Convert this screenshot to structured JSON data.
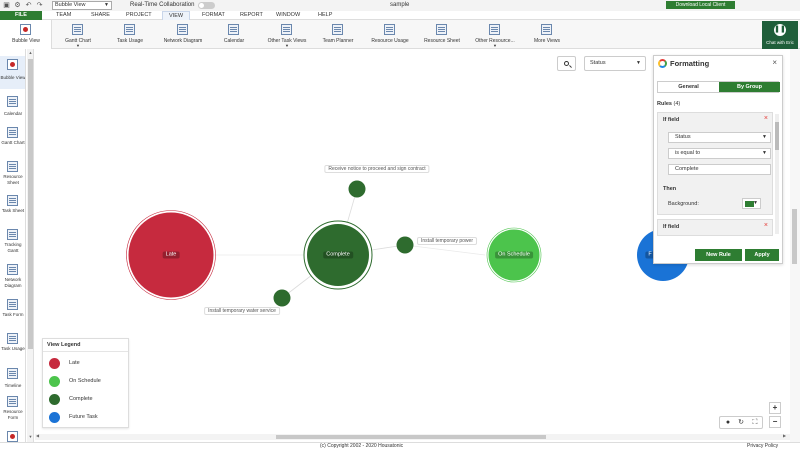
{
  "titlebar": {
    "view_name": "Bubble View",
    "rtc_label": "Real-Time Collaboration",
    "doc_title": "sample",
    "download_label": "Download Local Client"
  },
  "menu": {
    "file": "FILE",
    "items": [
      "TEAM",
      "SHARE",
      "PROJECT",
      "VIEW",
      "FORMAT",
      "REPORT",
      "WINDOW",
      "HELP"
    ],
    "active": "VIEW"
  },
  "ribbon": {
    "items": [
      {
        "label": "Bubble View",
        "dropdown": false
      },
      {
        "label": "Gantt Chart",
        "dropdown": true
      },
      {
        "label": "Task Usage",
        "dropdown": false
      },
      {
        "label": "Network Diagram",
        "dropdown": false
      },
      {
        "label": "Calendar",
        "dropdown": false
      },
      {
        "label": "Other Task Views",
        "dropdown": true
      },
      {
        "label": "Team Planner",
        "dropdown": false
      },
      {
        "label": "Resource Usage",
        "dropdown": false
      },
      {
        "label": "Resource Sheet",
        "dropdown": false
      },
      {
        "label": "Other Resource...",
        "dropdown": true
      },
      {
        "label": "More Views",
        "dropdown": false
      }
    ],
    "dropdown_glyph": "▼",
    "chat_label": "Chat with Eric"
  },
  "left_toolbar": {
    "items": [
      {
        "label": "Bubble View",
        "active": true
      },
      {
        "label": "Calendar"
      },
      {
        "label": "Gantt Chart"
      },
      {
        "label": "Resource Sheet"
      },
      {
        "label": "Task Sheet"
      },
      {
        "label": "Tracking Gantt"
      },
      {
        "label": "Network Diagram"
      },
      {
        "label": "Task Form"
      },
      {
        "label": "Task Usage"
      },
      {
        "label": "Timeline"
      },
      {
        "label": "Resource Form"
      }
    ]
  },
  "canvas": {
    "status_select": "Status",
    "bubbles": [
      {
        "label": "Late",
        "color": "#c62a3e"
      },
      {
        "label": "Complete",
        "color": "#2e6b2e"
      },
      {
        "label": "On Schedule",
        "color": "#4cc44c"
      },
      {
        "label": "F",
        "color": "#1a73d6"
      }
    ],
    "tasks": [
      {
        "label": "Receive notice to proceed and sign contract"
      },
      {
        "label": "Install temporary power"
      },
      {
        "label": "Install temporary water service"
      }
    ]
  },
  "legend": {
    "title": "View Legend",
    "items": [
      {
        "label": "Late",
        "color": "#c62a3e"
      },
      {
        "label": "On Schedule",
        "color": "#4cc44c"
      },
      {
        "label": "Complete",
        "color": "#2e6b2e"
      },
      {
        "label": "Future Task",
        "color": "#1a73d6"
      }
    ]
  },
  "formatting": {
    "title": "Formatting",
    "tab_general": "General",
    "tab_by_group": "By Group",
    "rules_label": "Rules",
    "rules_count": "(4)",
    "rule1": {
      "title": "If field",
      "field": "Status",
      "operator": "is equal to",
      "value": "Complete",
      "then": "Then",
      "background_label": "Background:",
      "background_color": "#2e7d32"
    },
    "rule2_title": "If field",
    "new_rule": "New Rule",
    "apply": "Apply"
  },
  "footer": {
    "copyright": "(c) Copyright 2002 - 2020 Housatonic",
    "privacy": "Privacy Policy"
  },
  "colors": {
    "brand_green": "#2e7d32",
    "late_red": "#c62a3e",
    "complete_green": "#2e6b2e",
    "schedule_green": "#4cc44c",
    "future_blue": "#1a73d6"
  }
}
